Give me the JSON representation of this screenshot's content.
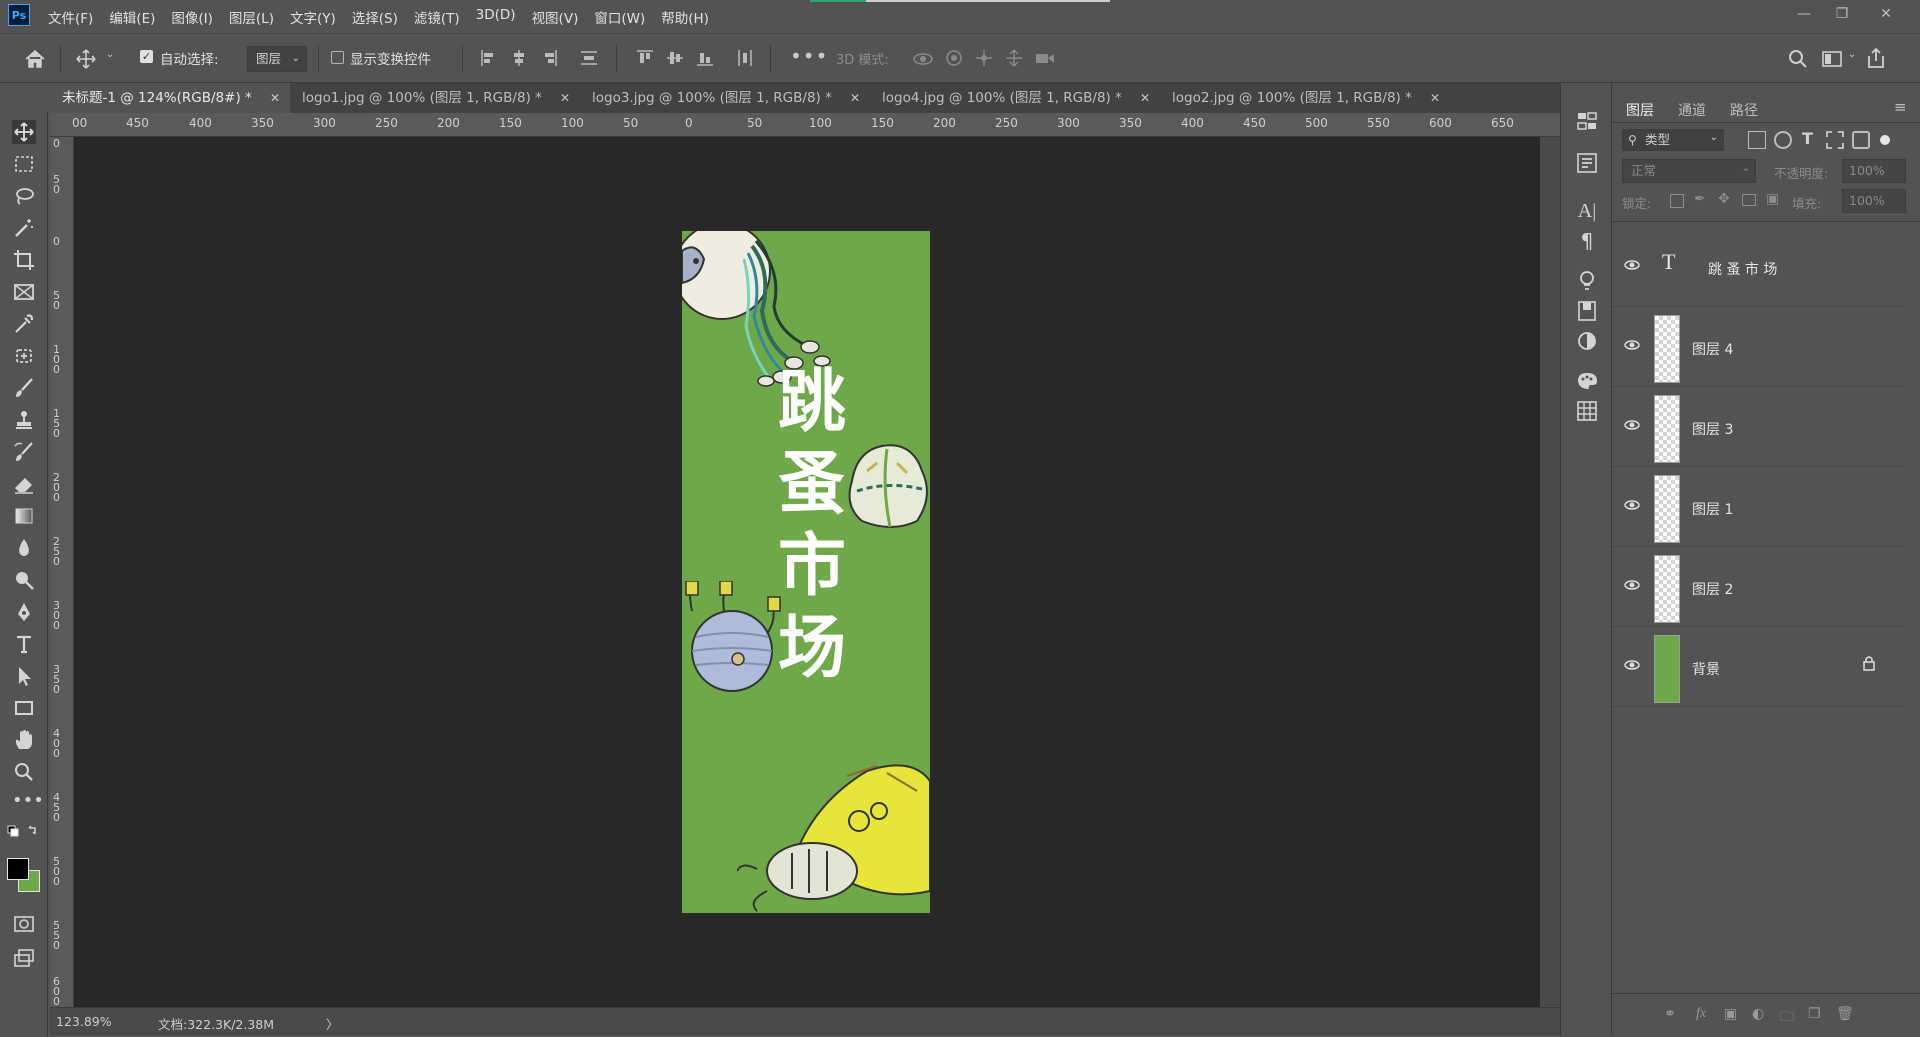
{
  "app": {
    "logo": "Ps"
  },
  "menu": [
    "文件(F)",
    "编辑(E)",
    "图像(I)",
    "图层(L)",
    "文字(Y)",
    "选择(S)",
    "滤镜(T)",
    "3D(D)",
    "视图(V)",
    "窗口(W)",
    "帮助(H)"
  ],
  "options": {
    "auto_select_label": "自动选择:",
    "auto_select_value": "图层",
    "show_transform_label": "显示变换控件",
    "mode_3d_label": "3D 模式:"
  },
  "tabs": [
    {
      "label": "未标题-1 @ 124%(RGB/8#) *",
      "active": true
    },
    {
      "label": "logo1.jpg @ 100% (图层 1, RGB/8) *",
      "active": false
    },
    {
      "label": "logo3.jpg @ 100% (图层 1, RGB/8) *",
      "active": false
    },
    {
      "label": "logo4.jpg @ 100% (图层 1, RGB/8) *",
      "active": false
    },
    {
      "label": "logo2.jpg @ 100% (图层 1, RGB/8) *",
      "active": false
    }
  ],
  "ruler_top": [
    "00",
    "450",
    "400",
    "350",
    "300",
    "250",
    "200",
    "150",
    "100",
    "50",
    "0",
    "50",
    "100",
    "150",
    "200",
    "250",
    "300",
    "350",
    "400",
    "450",
    "500",
    "550",
    "600",
    "650"
  ],
  "ruler_left": [
    "0",
    "5\n0",
    "0",
    "5\n0",
    "1\n0\n0",
    "1\n5\n0",
    "2\n0\n0",
    "2\n5\n0",
    "3\n0\n0",
    "3\n5\n0",
    "4\n0\n0",
    "4\n5\n0",
    "5\n0\n0",
    "5\n5\n0",
    "6\n0\n0"
  ],
  "canvas": {
    "title_chars": [
      "跳",
      "蚤",
      "市",
      "场"
    ],
    "background_color": "#6ea849"
  },
  "status": {
    "zoom": "123.89%",
    "doc": "文档:322.3K/2.38M",
    "arrow": "〉"
  },
  "panel": {
    "tabs": [
      "图层",
      "通道",
      "路径"
    ],
    "filter_kind": "类型",
    "blend_mode": "正常",
    "opacity_label": "不透明度:",
    "opacity_value": "100%",
    "lock_label": "锁定:",
    "fill_label": "填充:",
    "fill_value": "100%",
    "layers": [
      {
        "name": "跳 蚤 市 场",
        "type": "text"
      },
      {
        "name": "图层 4",
        "type": "pixel"
      },
      {
        "name": "图层 3",
        "type": "pixel"
      },
      {
        "name": "图层 1",
        "type": "pixel"
      },
      {
        "name": "图层 2",
        "type": "pixel"
      },
      {
        "name": "背景",
        "type": "background",
        "locked": true
      }
    ]
  },
  "colors": {
    "foreground": "#000000",
    "background": "#6ea849"
  }
}
